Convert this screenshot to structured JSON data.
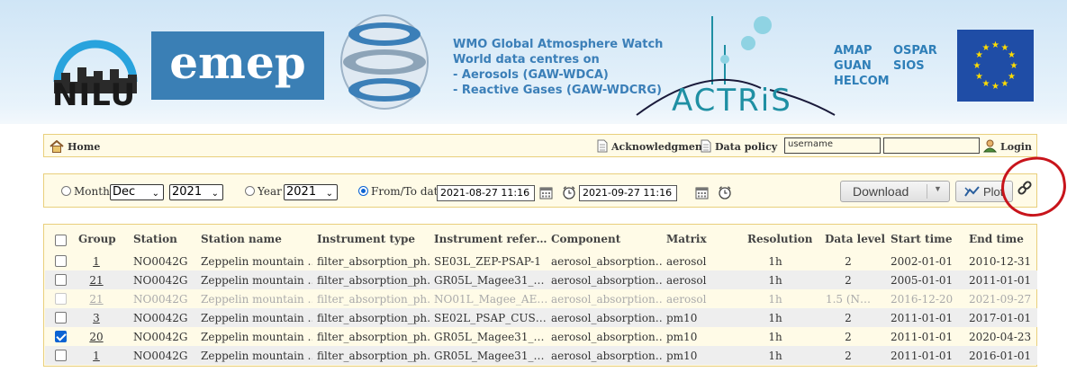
{
  "banner": {
    "nilu_text": "NILU",
    "emep_text": "emep",
    "gaw_lines": [
      "WMO Global Atmosphere Watch",
      "World data centres on",
      "- Aerosols (GAW-WDCA)",
      "- Reactive Gases (GAW-WDCRG)"
    ],
    "actris_text": "ACTRiS",
    "orgs_left": [
      "AMAP",
      "GUAN",
      "HELCOM"
    ],
    "orgs_right": [
      "OSPAR",
      "SIOS"
    ]
  },
  "nav": {
    "home": "Home",
    "acknowledgment": "Acknowledgment",
    "data_policy": "Data policy",
    "username_value": "username",
    "password_value": "",
    "login": "Login"
  },
  "filters": {
    "month_label": "Month",
    "month_value": "Dec",
    "month_year_value": "2021",
    "year_label": "Year",
    "year_value": "2021",
    "fromto_label": "From/To date",
    "from_date": "2021-08-27 11:16",
    "to_date": "2021-09-27 11:16",
    "selected_mode": "fromto",
    "download_label": "Download",
    "plot_label": "Plot"
  },
  "table": {
    "headers": [
      "Group",
      "Station",
      "Station name",
      "Instrument type",
      "Instrument refer…",
      "Component",
      "Matrix",
      "Resolution",
      "Data level",
      "Start time",
      "End time"
    ],
    "rows": [
      {
        "checked": false,
        "disabled": false,
        "group": "1",
        "station": "NO0042G",
        "station_name": "Zeppelin mountain …",
        "instrument_type": "filter_absorption_ph…",
        "instrument_ref": "SE03L_ZEP-PSAP-1",
        "component": "aerosol_absorption…",
        "matrix": "aerosol",
        "resolution": "1h",
        "data_level": "2",
        "start": "2002-01-01",
        "end": "2010-12-31"
      },
      {
        "checked": false,
        "disabled": false,
        "group": "21",
        "station": "NO0042G",
        "station_name": "Zeppelin mountain …",
        "instrument_type": "filter_absorption_ph…",
        "instrument_ref": "GR05L_Magee31_…",
        "component": "aerosol_absorption…",
        "matrix": "aerosol",
        "resolution": "1h",
        "data_level": "2",
        "start": "2005-01-01",
        "end": "2011-01-01"
      },
      {
        "checked": false,
        "disabled": true,
        "group": "21",
        "station": "NO0042G",
        "station_name": "Zeppelin mountain …",
        "instrument_type": "filter_absorption_ph…",
        "instrument_ref": "NO01L_Magee_AE…",
        "component": "aerosol_absorption…",
        "matrix": "aerosol",
        "resolution": "1h",
        "data_level": "1.5 (N…",
        "start": "2016-12-20",
        "end": "2021-09-27"
      },
      {
        "checked": false,
        "disabled": false,
        "group": "3",
        "station": "NO0042G",
        "station_name": "Zeppelin mountain …",
        "instrument_type": "filter_absorption_ph…",
        "instrument_ref": "SE02L_PSAP_CUS…",
        "component": "aerosol_absorption…",
        "matrix": "pm10",
        "resolution": "1h",
        "data_level": "2",
        "start": "2011-01-01",
        "end": "2017-01-01"
      },
      {
        "checked": true,
        "disabled": false,
        "group": "20",
        "station": "NO0042G",
        "station_name": "Zeppelin mountain …",
        "instrument_type": "filter_absorption_ph…",
        "instrument_ref": "GR05L_Magee31_…",
        "component": "aerosol_absorption…",
        "matrix": "pm10",
        "resolution": "1h",
        "data_level": "2",
        "start": "2011-01-01",
        "end": "2020-04-23"
      },
      {
        "checked": false,
        "disabled": false,
        "group": "1",
        "station": "NO0042G",
        "station_name": "Zeppelin mountain …",
        "instrument_type": "filter_absorption_ph…",
        "instrument_ref": "GR05L_Magee31_…",
        "component": "aerosol_absorption…",
        "matrix": "pm10",
        "resolution": "1h",
        "data_level": "2",
        "start": "2011-01-01",
        "end": "2016-01-01"
      }
    ]
  }
}
